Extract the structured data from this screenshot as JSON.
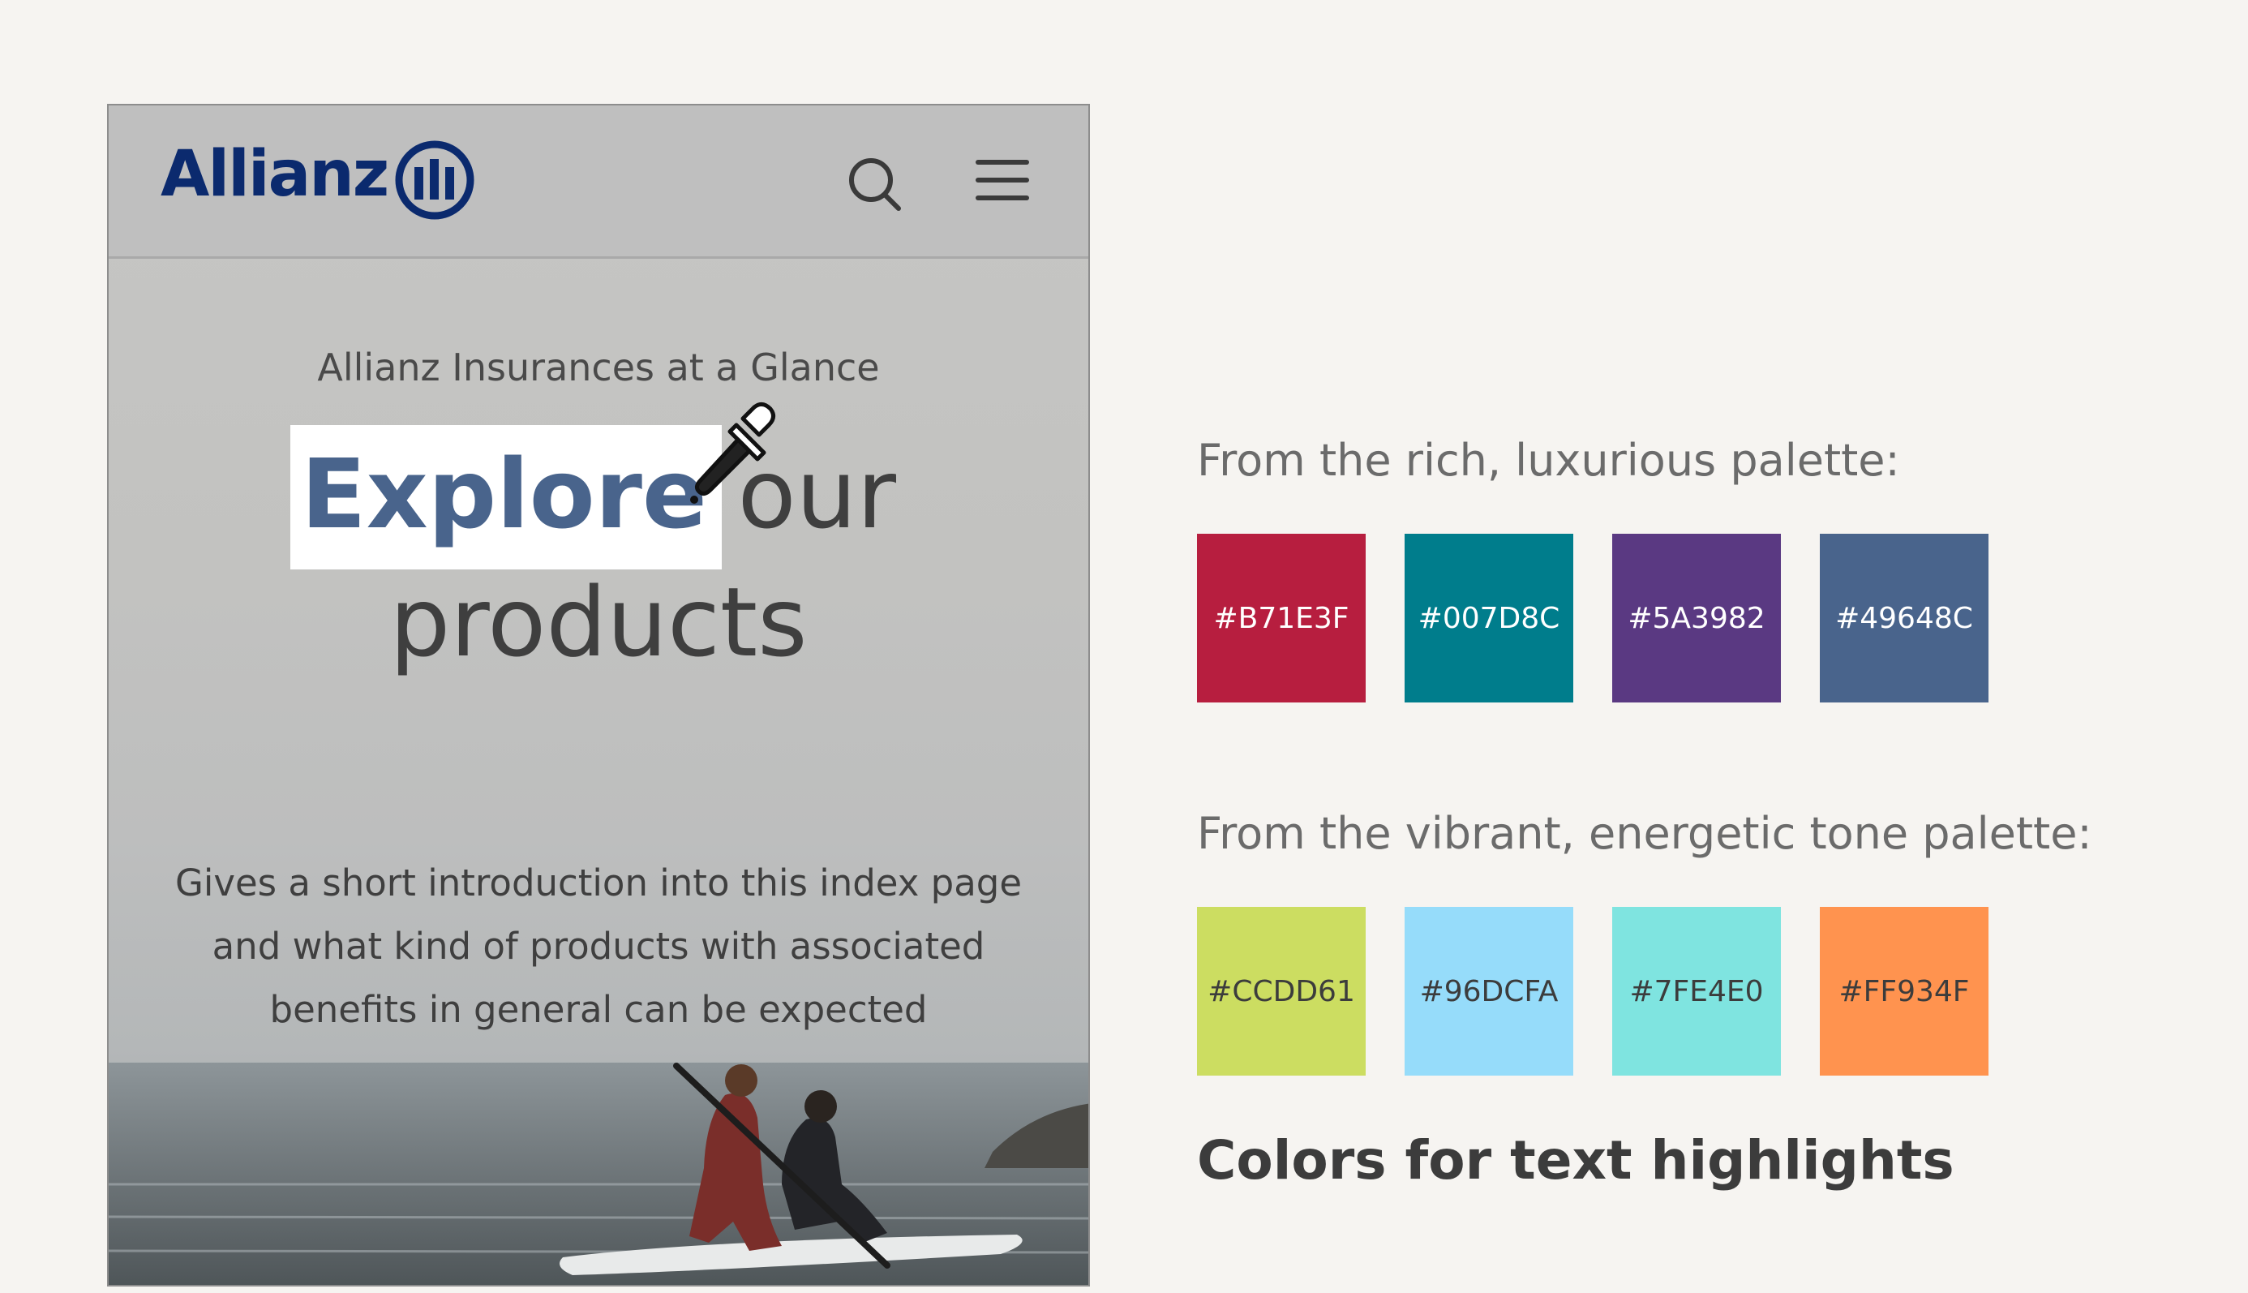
{
  "mockup": {
    "logo_text": "Allianz",
    "eyebrow": "Allianz Insurances at a Glance",
    "headline_highlight": "Explore",
    "headline_rest_line1": " our",
    "headline_line2": "products",
    "intro_line1": "Gives a short introduction into this index page",
    "intro_line2": "and what kind of products with associated",
    "intro_line3": "benefits in general can be expected",
    "highlight_color": "#49648c",
    "icons": [
      "allianz-logo-icon",
      "search-icon",
      "menu-icon",
      "eyedropper-icon"
    ]
  },
  "palettes": {
    "rich": {
      "title": "From the rich, luxurious palette:",
      "swatches": [
        {
          "label": "#B71E3F",
          "color": "#B71E3F"
        },
        {
          "label": "#007D8C",
          "color": "#007D8C"
        },
        {
          "label": "#5A3982",
          "color": "#5A3982"
        },
        {
          "label": "#49648C",
          "color": "#49648C"
        }
      ]
    },
    "vibrant": {
      "title": "From the vibrant, energetic tone palette:",
      "swatches": [
        {
          "label": "#CCDD61",
          "color": "#CCDD61"
        },
        {
          "label": "#96DCFA",
          "color": "#96DCFA"
        },
        {
          "label": "#7FE4E0",
          "color": "#7FE4E0"
        },
        {
          "label": "#FF934F",
          "color": "#FF934F"
        }
      ]
    },
    "caption": "Colors for text highlights"
  }
}
